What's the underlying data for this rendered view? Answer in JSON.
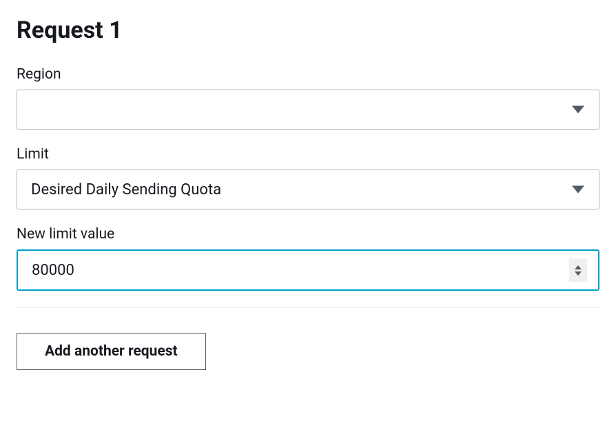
{
  "form": {
    "title": "Request 1",
    "fields": {
      "region": {
        "label": "Region",
        "selected": ""
      },
      "limit": {
        "label": "Limit",
        "selected": "Desired Daily Sending Quota"
      },
      "newLimitValue": {
        "label": "New limit value",
        "value": "80000"
      }
    },
    "addButton": {
      "label": "Add another request"
    }
  }
}
